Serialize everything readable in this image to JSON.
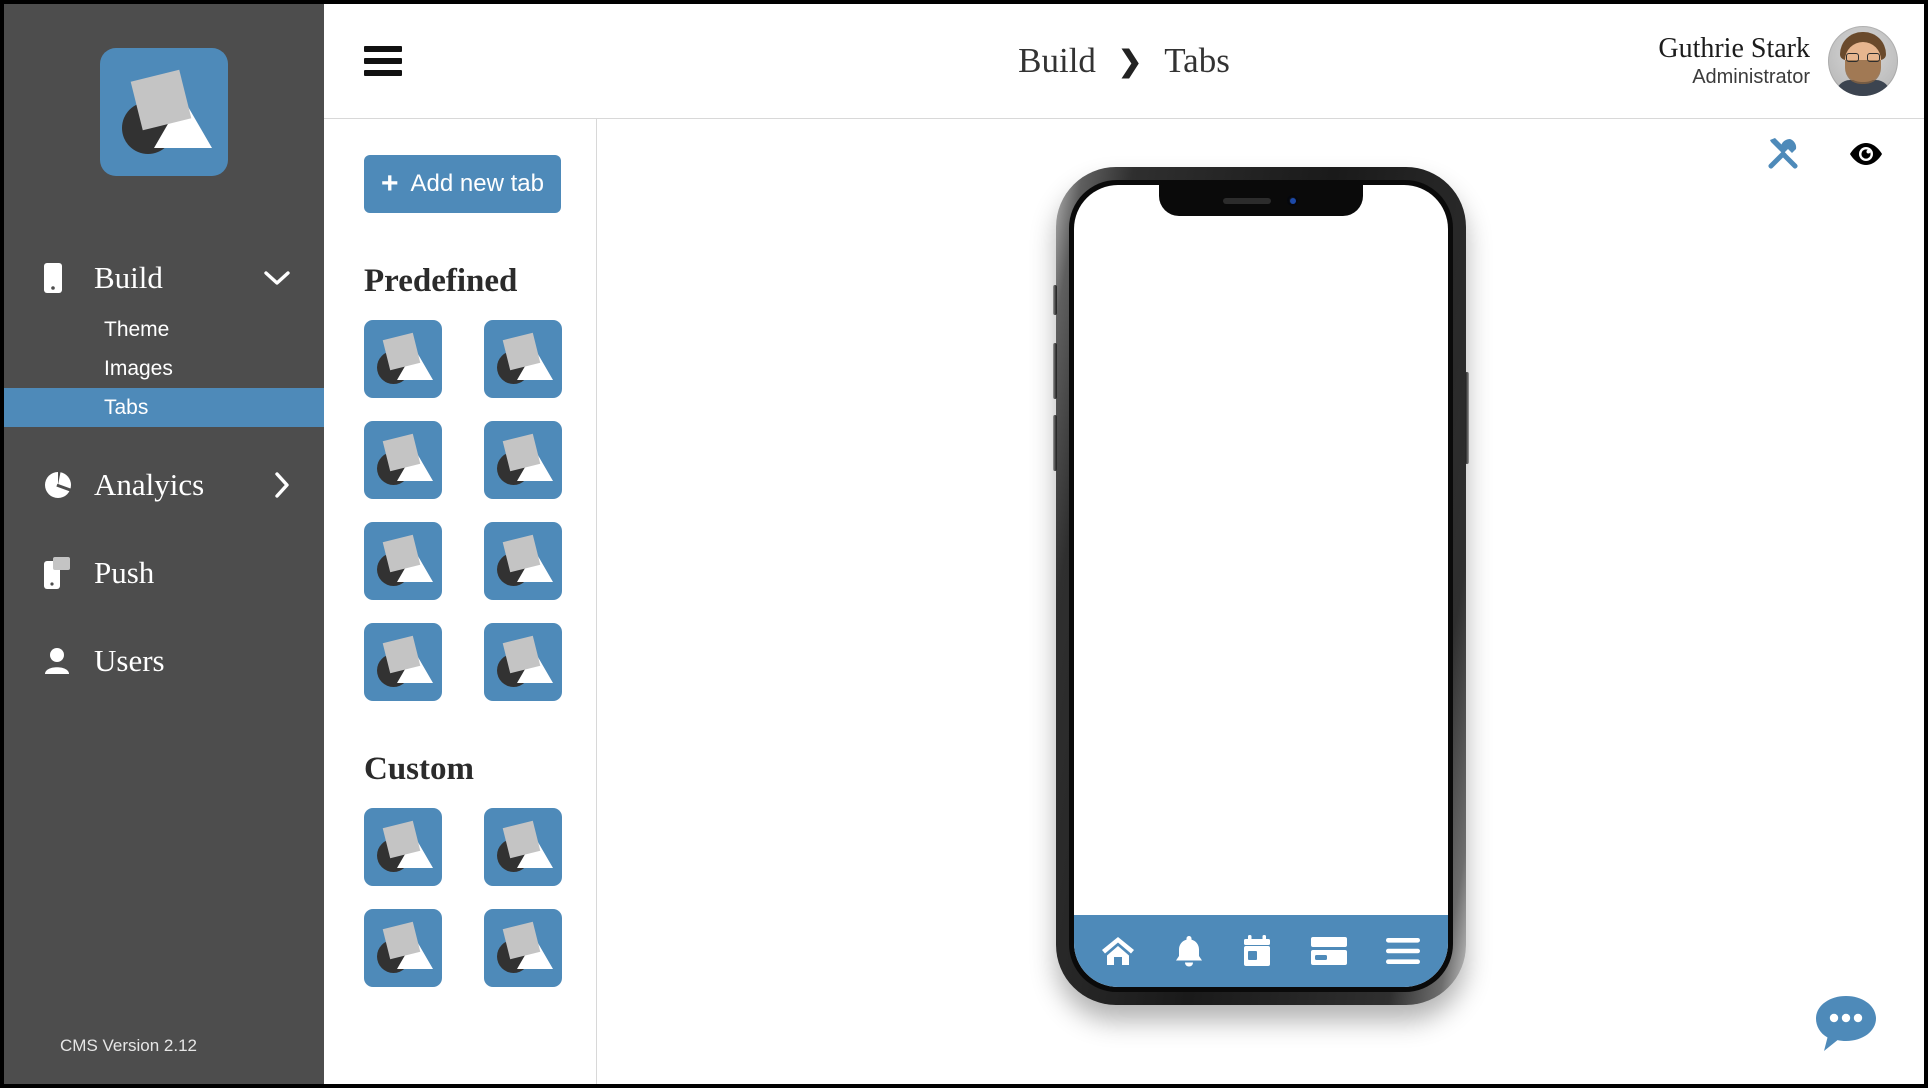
{
  "sidebar": {
    "logo": "app-logo",
    "nav": [
      {
        "label": "Build",
        "icon": "mobile-icon",
        "chevron": "chevron-down-icon",
        "expanded": true,
        "children": [
          {
            "label": "Theme",
            "active": false
          },
          {
            "label": "Images",
            "active": false
          },
          {
            "label": "Tabs",
            "active": true
          }
        ]
      },
      {
        "label": "Analyics",
        "icon": "pie-chart-icon",
        "chevron": "chevron-right-icon",
        "expanded": false,
        "children": []
      },
      {
        "label": "Push",
        "icon": "push-notification-icon",
        "chevron": "",
        "expanded": false,
        "children": []
      },
      {
        "label": "Users",
        "icon": "user-icon",
        "chevron": "",
        "expanded": false,
        "children": []
      }
    ],
    "version": "CMS Version 2.12"
  },
  "header": {
    "menu_icon": "hamburger-icon",
    "breadcrumb": {
      "parent": "Build",
      "separator": "❯",
      "current": "Tabs"
    },
    "user": {
      "name": "Guthrie Stark",
      "role": "Administrator",
      "avatar": "user-avatar"
    }
  },
  "tab_panel": {
    "add_button": {
      "label": "Add new tab",
      "plus": "+"
    },
    "sections": [
      {
        "title": "Predefined",
        "icon_count": 8
      },
      {
        "title": "Custom",
        "icon_count": 4
      }
    ]
  },
  "preview": {
    "tools": [
      {
        "name": "settings-tools-icon",
        "color": "#4e8ab9"
      },
      {
        "name": "eye-preview-icon",
        "color": "#000000"
      }
    ],
    "device": "iphone-x-mockup",
    "tabbar": [
      {
        "name": "home-icon"
      },
      {
        "name": "bell-icon"
      },
      {
        "name": "calendar-icon"
      },
      {
        "name": "card-icon"
      },
      {
        "name": "menu-icon"
      }
    ],
    "chat_fab": "chat-bubble-icon"
  },
  "colors": {
    "accent": "#4e8ab9",
    "sidebar_bg": "#4d4d4d",
    "logo_square": "#c4c4c4",
    "logo_circle": "#323232"
  }
}
